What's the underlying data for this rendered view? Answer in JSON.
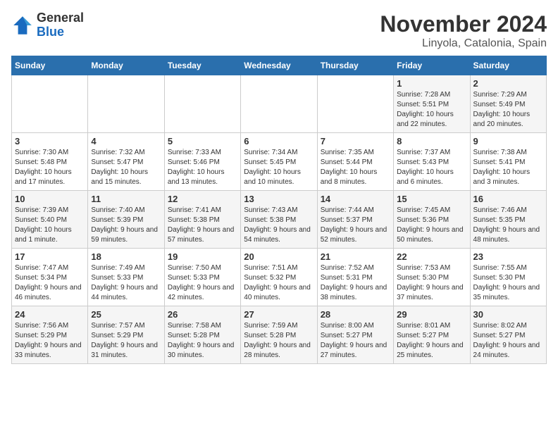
{
  "logo": {
    "general": "General",
    "blue": "Blue"
  },
  "title": "November 2024",
  "location": "Linyola, Catalonia, Spain",
  "days_header": [
    "Sunday",
    "Monday",
    "Tuesday",
    "Wednesday",
    "Thursday",
    "Friday",
    "Saturday"
  ],
  "weeks": [
    [
      {
        "num": "",
        "info": ""
      },
      {
        "num": "",
        "info": ""
      },
      {
        "num": "",
        "info": ""
      },
      {
        "num": "",
        "info": ""
      },
      {
        "num": "",
        "info": ""
      },
      {
        "num": "1",
        "info": "Sunrise: 7:28 AM\nSunset: 5:51 PM\nDaylight: 10 hours and 22 minutes."
      },
      {
        "num": "2",
        "info": "Sunrise: 7:29 AM\nSunset: 5:49 PM\nDaylight: 10 hours and 20 minutes."
      }
    ],
    [
      {
        "num": "3",
        "info": "Sunrise: 7:30 AM\nSunset: 5:48 PM\nDaylight: 10 hours and 17 minutes."
      },
      {
        "num": "4",
        "info": "Sunrise: 7:32 AM\nSunset: 5:47 PM\nDaylight: 10 hours and 15 minutes."
      },
      {
        "num": "5",
        "info": "Sunrise: 7:33 AM\nSunset: 5:46 PM\nDaylight: 10 hours and 13 minutes."
      },
      {
        "num": "6",
        "info": "Sunrise: 7:34 AM\nSunset: 5:45 PM\nDaylight: 10 hours and 10 minutes."
      },
      {
        "num": "7",
        "info": "Sunrise: 7:35 AM\nSunset: 5:44 PM\nDaylight: 10 hours and 8 minutes."
      },
      {
        "num": "8",
        "info": "Sunrise: 7:37 AM\nSunset: 5:43 PM\nDaylight: 10 hours and 6 minutes."
      },
      {
        "num": "9",
        "info": "Sunrise: 7:38 AM\nSunset: 5:41 PM\nDaylight: 10 hours and 3 minutes."
      }
    ],
    [
      {
        "num": "10",
        "info": "Sunrise: 7:39 AM\nSunset: 5:40 PM\nDaylight: 10 hours and 1 minute."
      },
      {
        "num": "11",
        "info": "Sunrise: 7:40 AM\nSunset: 5:39 PM\nDaylight: 9 hours and 59 minutes."
      },
      {
        "num": "12",
        "info": "Sunrise: 7:41 AM\nSunset: 5:38 PM\nDaylight: 9 hours and 57 minutes."
      },
      {
        "num": "13",
        "info": "Sunrise: 7:43 AM\nSunset: 5:38 PM\nDaylight: 9 hours and 54 minutes."
      },
      {
        "num": "14",
        "info": "Sunrise: 7:44 AM\nSunset: 5:37 PM\nDaylight: 9 hours and 52 minutes."
      },
      {
        "num": "15",
        "info": "Sunrise: 7:45 AM\nSunset: 5:36 PM\nDaylight: 9 hours and 50 minutes."
      },
      {
        "num": "16",
        "info": "Sunrise: 7:46 AM\nSunset: 5:35 PM\nDaylight: 9 hours and 48 minutes."
      }
    ],
    [
      {
        "num": "17",
        "info": "Sunrise: 7:47 AM\nSunset: 5:34 PM\nDaylight: 9 hours and 46 minutes."
      },
      {
        "num": "18",
        "info": "Sunrise: 7:49 AM\nSunset: 5:33 PM\nDaylight: 9 hours and 44 minutes."
      },
      {
        "num": "19",
        "info": "Sunrise: 7:50 AM\nSunset: 5:33 PM\nDaylight: 9 hours and 42 minutes."
      },
      {
        "num": "20",
        "info": "Sunrise: 7:51 AM\nSunset: 5:32 PM\nDaylight: 9 hours and 40 minutes."
      },
      {
        "num": "21",
        "info": "Sunrise: 7:52 AM\nSunset: 5:31 PM\nDaylight: 9 hours and 38 minutes."
      },
      {
        "num": "22",
        "info": "Sunrise: 7:53 AM\nSunset: 5:30 PM\nDaylight: 9 hours and 37 minutes."
      },
      {
        "num": "23",
        "info": "Sunrise: 7:55 AM\nSunset: 5:30 PM\nDaylight: 9 hours and 35 minutes."
      }
    ],
    [
      {
        "num": "24",
        "info": "Sunrise: 7:56 AM\nSunset: 5:29 PM\nDaylight: 9 hours and 33 minutes."
      },
      {
        "num": "25",
        "info": "Sunrise: 7:57 AM\nSunset: 5:29 PM\nDaylight: 9 hours and 31 minutes."
      },
      {
        "num": "26",
        "info": "Sunrise: 7:58 AM\nSunset: 5:28 PM\nDaylight: 9 hours and 30 minutes."
      },
      {
        "num": "27",
        "info": "Sunrise: 7:59 AM\nSunset: 5:28 PM\nDaylight: 9 hours and 28 minutes."
      },
      {
        "num": "28",
        "info": "Sunrise: 8:00 AM\nSunset: 5:27 PM\nDaylight: 9 hours and 27 minutes."
      },
      {
        "num": "29",
        "info": "Sunrise: 8:01 AM\nSunset: 5:27 PM\nDaylight: 9 hours and 25 minutes."
      },
      {
        "num": "30",
        "info": "Sunrise: 8:02 AM\nSunset: 5:27 PM\nDaylight: 9 hours and 24 minutes."
      }
    ]
  ]
}
